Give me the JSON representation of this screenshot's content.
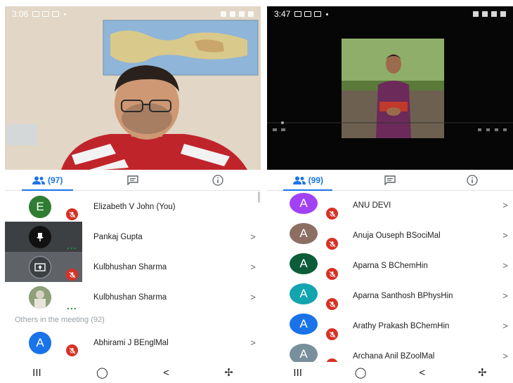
{
  "left": {
    "status_time": "3:06",
    "tabs": {
      "people_count": "(97)"
    },
    "participants": [
      {
        "name": "Elizabeth V John (You)",
        "initial": "E",
        "color": "#2e7d32",
        "muted": true
      },
      {
        "name": "Pankaj Gupta",
        "initial": "",
        "color": "#222222",
        "muted": false,
        "speaking": true,
        "tile": "dark"
      },
      {
        "name": "Kulbhushan Sharma",
        "initial": "",
        "color": "#222222",
        "muted": true,
        "tile": "screen"
      },
      {
        "name": "Kulbhushan Sharma",
        "initial": "",
        "color": "#7a8a6a",
        "muted": false,
        "speaking": true,
        "tile": "photo"
      }
    ],
    "others_label": "Others in the meeting (92)",
    "others": [
      {
        "name": "Abhirami J BEnglMal",
        "initial": "A",
        "color": "#1a73e8",
        "muted": true
      }
    ],
    "speaking_dots": "..."
  },
  "right": {
    "status_time": "3:47",
    "tabs": {
      "people_count": "(99)"
    },
    "participants": [
      {
        "name": "ANU DEVI",
        "initial": "A",
        "color": "#a142f4",
        "muted": true
      },
      {
        "name": "Anuja Ouseph BSociMal",
        "initial": "A",
        "color": "#8d6e63",
        "muted": true
      },
      {
        "name": "Aparna S BChemHin",
        "initial": "A",
        "color": "#0d5c3a",
        "muted": true
      },
      {
        "name": "Aparna Santhosh BPhysHin",
        "initial": "A",
        "color": "#12a4af",
        "muted": true
      },
      {
        "name": "Arathy Prakash BChemHin",
        "initial": "A",
        "color": "#1a73e8",
        "muted": true
      },
      {
        "name": "Archana Anil BZoolMal",
        "initial": "A",
        "color": "#78909c",
        "muted": true
      }
    ]
  },
  "chevron": ">",
  "colors": {
    "accent": "#1a73e8",
    "muted": "#d93025",
    "speaking": "#1e8e3e"
  },
  "icons": [
    "people-icon",
    "chat-icon",
    "info-icon",
    "mic-off-icon",
    "chevron-right-icon",
    "recents-icon",
    "home-icon",
    "back-icon",
    "accessibility-icon"
  ],
  "nav": {
    "recents": "III",
    "home": "◯",
    "back": "<",
    "accessibility": "✢"
  }
}
